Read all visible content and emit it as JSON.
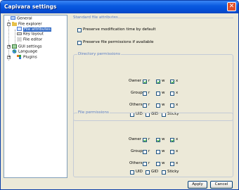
{
  "window": {
    "title": "Capivara settings"
  },
  "tree": {
    "items": [
      {
        "label": "General"
      },
      {
        "label": "File explorer"
      },
      {
        "label": "File attributes"
      },
      {
        "label": "Key layout"
      },
      {
        "label": "File editor"
      },
      {
        "label": "GUI settings"
      },
      {
        "label": "Language"
      },
      {
        "label": "Plugins"
      }
    ]
  },
  "main": {
    "section_title": "Standard file attributes",
    "preserve_mod_time": {
      "label": "Preserve modification time by default",
      "checked": false
    },
    "preserve_permissions": {
      "label": "Preserve file permissions if available",
      "checked": false
    },
    "directory_permissions": {
      "title": "Directory permissions",
      "owner": "Owner",
      "group": "Group",
      "others": "Others",
      "r": "r",
      "w": "w",
      "x": "x",
      "uid": "UID",
      "gid": "GID",
      "sticky": "Sticky"
    },
    "file_permissions": {
      "title": "File permissions",
      "owner": "Owner",
      "group": "Group",
      "others": "Others",
      "r": "r",
      "w": "w",
      "x": "x",
      "uid": "UID",
      "gid": "GID",
      "sticky": "Sticky"
    }
  },
  "footer": {
    "apply_label": "Apply",
    "cancel_label": "Cancel"
  }
}
